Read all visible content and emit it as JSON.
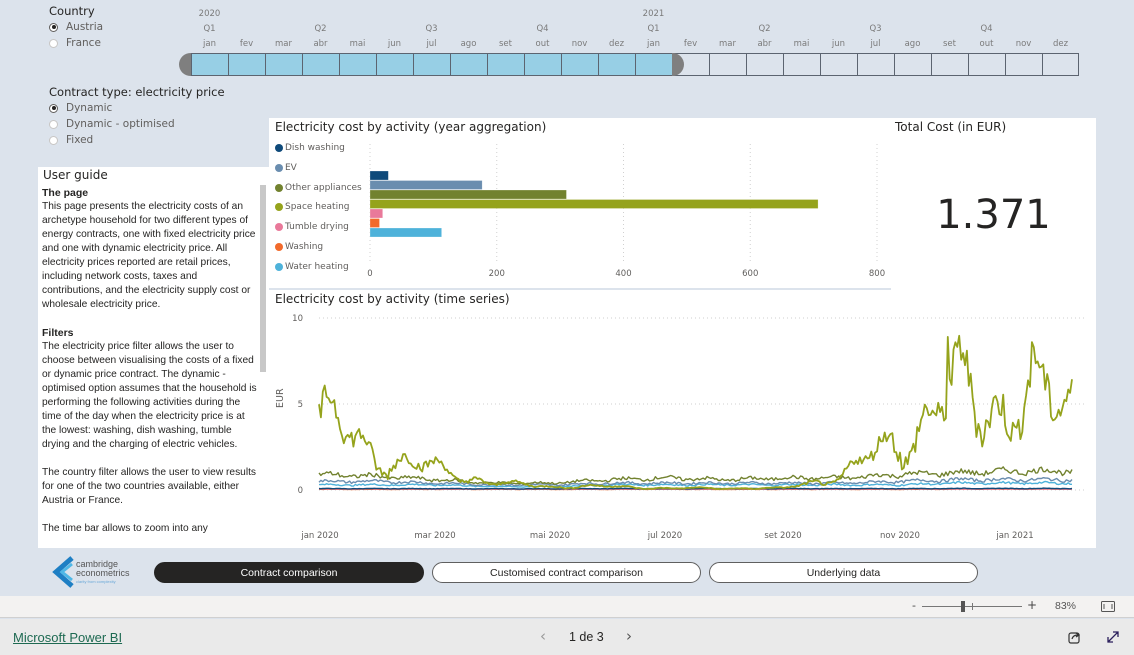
{
  "country_slicer": {
    "title": "Country",
    "options": [
      {
        "label": "Austria",
        "selected": true
      },
      {
        "label": "France",
        "selected": false
      }
    ]
  },
  "contract_slicer": {
    "title": "Contract type: electricity price",
    "options": [
      {
        "label": "Dynamic",
        "selected": true
      },
      {
        "label": "Dynamic - optimised",
        "selected": false
      },
      {
        "label": "Fixed",
        "selected": false
      }
    ]
  },
  "timeline": {
    "years": [
      {
        "label": "2020",
        "month_index": 0
      },
      {
        "label": "2021",
        "month_index": 12
      }
    ],
    "quarters": [
      {
        "label": "Q1",
        "month_index": 0
      },
      {
        "label": "Q2",
        "month_index": 3
      },
      {
        "label": "Q3",
        "month_index": 6
      },
      {
        "label": "Q4",
        "month_index": 9
      },
      {
        "label": "Q1",
        "month_index": 12
      },
      {
        "label": "Q2",
        "month_index": 15
      },
      {
        "label": "Q3",
        "month_index": 18
      },
      {
        "label": "Q4",
        "month_index": 21
      }
    ],
    "months": [
      "jan",
      "fev",
      "mar",
      "abr",
      "mai",
      "jun",
      "jul",
      "ago",
      "set",
      "out",
      "nov",
      "dez",
      "jan",
      "fev",
      "mar",
      "abr",
      "mai",
      "jun",
      "jul",
      "ago",
      "set",
      "out",
      "nov",
      "dez"
    ],
    "selected_range": {
      "start": "jan 2020",
      "end": "jan 2021",
      "selected_month_count": 13
    },
    "selected_color": "#97cfe5"
  },
  "user_guide": {
    "title": "User guide",
    "sections": [
      {
        "heading": "The page",
        "text": "This page presents the electricity costs of an archetype household for two different types of energy contracts, one with fixed electricity price and one with dynamic electricity price. All electricity prices reported are retail prices, including network costs, taxes and contributions, and the electricity supply cost or wholesale electricity price."
      },
      {
        "heading": "Filters",
        "text": "The electricity price filter allows the user to choose between visualising the costs of a fixed or dynamic price contract. The dynamic - optimised option assumes that the household is performing the following activities during the time of the day when the electricity price is at the lowest: washing, dish washing, tumble drying and the charging of electric vehicles."
      },
      {
        "heading": "",
        "text": "The country filter allows the user to view results for one of the two countries available, either Austria or France."
      },
      {
        "heading": "",
        "text": "The time bar allows to zoom into any"
      }
    ]
  },
  "total_cost": {
    "title": "Total Cost (in EUR)",
    "value": "1.371"
  },
  "chart_data": [
    {
      "type": "bar",
      "orientation": "horizontal",
      "title": "Electricity cost by activity (year aggregation)",
      "categories": [
        "Dish washing",
        "EV",
        "Other appliances",
        "Space heating",
        "Tumble drying",
        "Washing",
        "Water heating"
      ],
      "values": [
        29,
        177,
        310,
        707,
        20,
        15,
        113
      ],
      "colors": [
        "#0f4a7a",
        "#6a8daf",
        "#72822f",
        "#95a31c",
        "#e9799a",
        "#f26a2b",
        "#4eb2da"
      ],
      "xlim": [
        0,
        800
      ],
      "xticks": [
        0,
        200,
        400,
        600,
        800
      ],
      "legend": "left",
      "grid": true
    },
    {
      "type": "line",
      "title": "Electricity cost by activity (time series)",
      "ylabel": "EUR",
      "ylim": [
        -2.5,
        10
      ],
      "yticks": [
        0,
        5,
        10
      ],
      "xticks": [
        "jan 2020",
        "mar 2020",
        "mai 2020",
        "jul 2020",
        "set 2020",
        "nov 2020",
        "jan 2021"
      ],
      "x_range": [
        "2020-01-01",
        "2021-01-31"
      ],
      "grid": true,
      "series": [
        {
          "name": "Space heating",
          "color": "#95a31c",
          "monthly_approx": [
            4.2,
            2.0,
            1.2,
            0.4,
            0.2,
            0.2,
            0.1,
            0.1,
            0.1,
            0.8,
            3.0,
            5.5,
            5.0
          ],
          "peak": 8.9
        },
        {
          "name": "Other appliances",
          "color": "#72822f",
          "monthly_approx": [
            0.9,
            0.8,
            0.6,
            0.4,
            0.4,
            0.6,
            0.7,
            0.6,
            0.7,
            0.7,
            0.9,
            1.0,
            1.1
          ]
        },
        {
          "name": "EV",
          "color": "#6a8daf",
          "monthly_approx": [
            0.5,
            0.5,
            0.4,
            0.3,
            0.3,
            0.4,
            0.4,
            0.4,
            0.4,
            0.4,
            0.5,
            0.6,
            0.6
          ]
        },
        {
          "name": "Water heating",
          "color": "#4eb2da",
          "monthly_approx": [
            0.3,
            0.3,
            0.3,
            0.2,
            0.2,
            0.3,
            0.3,
            0.3,
            0.3,
            0.3,
            0.3,
            0.4,
            0.4
          ]
        },
        {
          "name": "Dish washing",
          "color": "#0f4a7a",
          "monthly_approx": [
            0.08,
            0.08,
            0.08,
            0.07,
            0.07,
            0.08,
            0.08,
            0.08,
            0.08,
            0.08,
            0.08,
            0.09,
            0.09
          ]
        },
        {
          "name": "Tumble drying",
          "color": "#e9799a",
          "monthly_approx": [
            0.06,
            0.06,
            0.05,
            0.05,
            0.05,
            0.05,
            0.05,
            0.05,
            0.05,
            0.05,
            0.06,
            0.06,
            0.06
          ]
        },
        {
          "name": "Washing",
          "color": "#f26a2b",
          "monthly_approx": [
            0.04,
            0.04,
            0.04,
            0.04,
            0.04,
            0.04,
            0.04,
            0.04,
            0.04,
            0.04,
            0.04,
            0.05,
            0.05
          ]
        }
      ]
    }
  ],
  "nav_buttons": [
    {
      "label": "Contract comparison",
      "active": true
    },
    {
      "label": "Customised contract comparison",
      "active": false
    },
    {
      "label": "Underlying data",
      "active": false
    }
  ],
  "logo": {
    "line1": "cambridge",
    "line2": "econometrics",
    "tagline": "clarity from complexity"
  },
  "zoom": {
    "minus": "-",
    "plus": "+",
    "value": "83%",
    "level_percent": 83
  },
  "footer": {
    "brand_link": "Microsoft Power BI",
    "page_indicator": "1 de 3",
    "prev": "‹",
    "next": "›"
  },
  "icons": {
    "share": "share-icon",
    "fullscreen": "expand-icon",
    "fit_page": "fit-to-page-icon"
  }
}
